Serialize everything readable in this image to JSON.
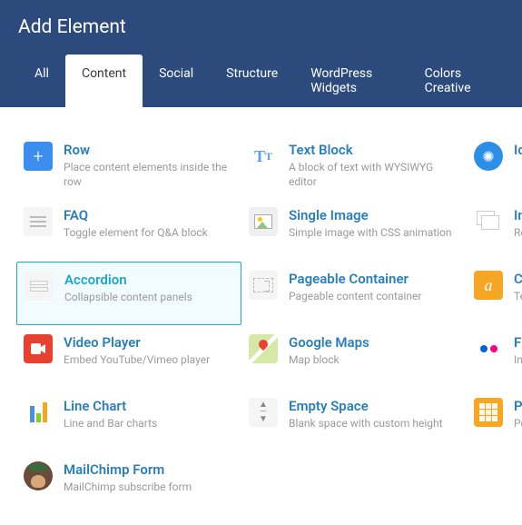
{
  "title": "Add Element",
  "tabs": [
    "All",
    "Content",
    "Social",
    "Structure",
    "WordPress Widgets",
    "Colors Creative"
  ],
  "active_tab": 1,
  "selected_element": "accordion",
  "col1": [
    {
      "id": "row",
      "name": "Row",
      "desc": "Place content elements inside the row"
    },
    {
      "id": "faq",
      "name": "FAQ",
      "desc": "Toggle element for Q&A block"
    },
    {
      "id": "accordion",
      "name": "Accordion",
      "desc": "Collapsible content panels"
    },
    {
      "id": "video",
      "name": "Video Player",
      "desc": "Embed YouTube/Vimeo player"
    },
    {
      "id": "linechart",
      "name": "Line Chart",
      "desc": "Line and Bar charts"
    },
    {
      "id": "mailchimp",
      "name": "MailChimp Form",
      "desc": "MailChimp subscribe form"
    }
  ],
  "col2": [
    {
      "id": "textblock",
      "name": "Text Block",
      "desc": "A block of text with WYSIWYG editor"
    },
    {
      "id": "singleimage",
      "name": "Single Image",
      "desc": "Simple image with CSS animation"
    },
    {
      "id": "pageable",
      "name": "Pageable Container",
      "desc": "Pageable content container"
    },
    {
      "id": "gmaps",
      "name": "Google Maps",
      "desc": "Map block"
    },
    {
      "id": "empty",
      "name": "Empty Space",
      "desc": "Blank space with custom height"
    }
  ],
  "col3": [
    {
      "id": "icon",
      "name": "Ic",
      "desc": ""
    },
    {
      "id": "multi",
      "name": "In",
      "desc": "Re"
    },
    {
      "id": "custom",
      "name": "Cu",
      "desc": "Te"
    },
    {
      "id": "flickr",
      "name": "Fl",
      "desc": "Im"
    },
    {
      "id": "posts",
      "name": "Po",
      "desc": "Po"
    }
  ]
}
